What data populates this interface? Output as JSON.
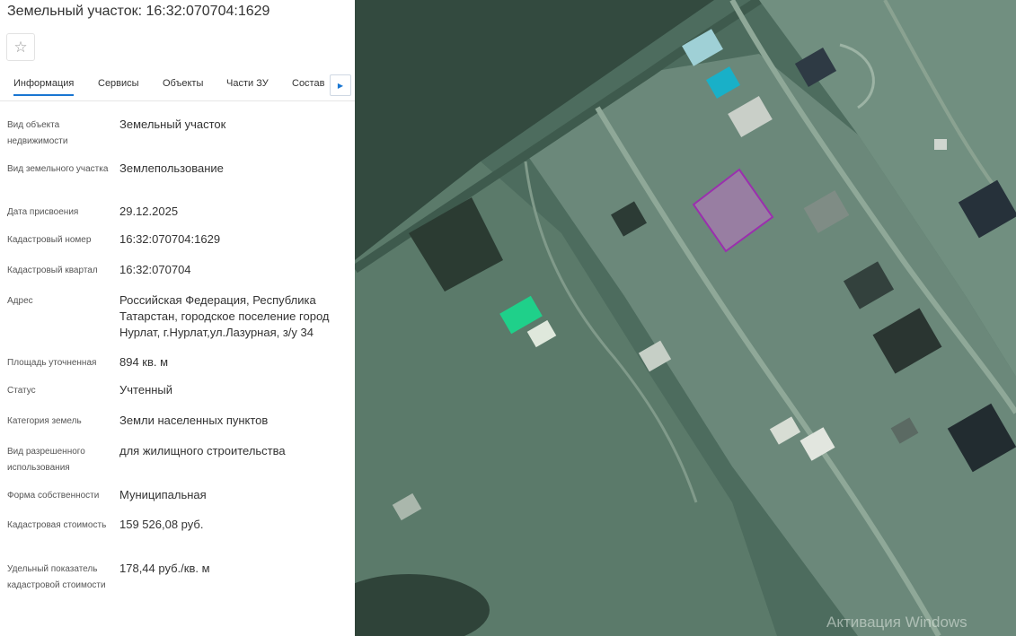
{
  "header": {
    "title": "Земельный участок: 16:32:070704:1629",
    "favorite_icon": "star-icon"
  },
  "tabs": [
    {
      "label": "Информация",
      "active": true
    },
    {
      "label": "Сервисы",
      "active": false
    },
    {
      "label": "Объекты",
      "active": false
    },
    {
      "label": "Части ЗУ",
      "active": false
    },
    {
      "label": "Состав",
      "active": false
    }
  ],
  "tabs_scroll_icon": "chevron-right-icon",
  "info": [
    {
      "label": "Вид объекта недвижимости",
      "value": "Земельный участок"
    },
    {
      "label": "Вид земельного участка",
      "value": "Землепользование"
    },
    {
      "label": "Дата присвоения",
      "value": "29.12.2025"
    },
    {
      "label": "Кадастровый номер",
      "value": "16:32:070704:1629"
    },
    {
      "label": "Кадастровый квартал",
      "value": "16:32:070704"
    },
    {
      "label": "Адрес",
      "value": "Российская Федерация, Республика Татарстан, городское поселение город Нурлат, г.Нурлат,ул.Лазурная, з/у 34"
    },
    {
      "label": "Площадь уточненная",
      "value": "894 кв. м"
    },
    {
      "label": "Статус",
      "value": "Учтенный"
    },
    {
      "label": "Категория земель",
      "value": "Земли населенных пунктов"
    },
    {
      "label": "Вид разрешенного использования",
      "value": "для жилищного строительства"
    },
    {
      "label": "Форма собственности",
      "value": "Муниципальная"
    },
    {
      "label": "Кадастровая стоимость",
      "value": "159 526,08 руб."
    },
    {
      "label": "Удельный показатель кадастровой стоимости",
      "value": "178,44 руб./кв. м"
    }
  ],
  "map": {
    "parcel_outline_color": "#9b2fae",
    "parcel_fill_color": "#b07ab8"
  },
  "watermark": "Активация Windows"
}
